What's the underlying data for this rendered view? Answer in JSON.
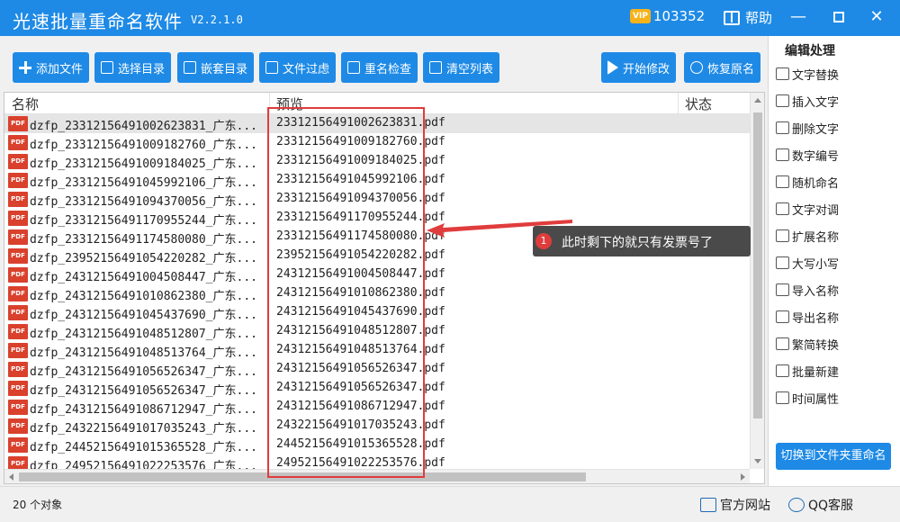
{
  "app": {
    "title": "光速批量重命名软件",
    "version": "V2.2.1.0",
    "vip_label": "VIP",
    "user_id": "103352",
    "help_label": "帮助",
    "window_controls": {
      "minimize": "—",
      "close": "✕"
    }
  },
  "toolbar": {
    "add_files": "添加文件",
    "select_dir": "选择目录",
    "nested_dir": "嵌套目录",
    "file_filter": "文件过虑",
    "rename_check": "重名检查",
    "clear_list": "清空列表",
    "start_modify": "开始修改",
    "restore_names": "恢复原名"
  },
  "list": {
    "headers": {
      "name": "名称",
      "preview": "预览",
      "status": "状态"
    },
    "rows": [
      {
        "name": "dzfp_23312156491002623831_广东...",
        "preview": "23312156491002623831.pdf"
      },
      {
        "name": "dzfp_23312156491009182760_广东...",
        "preview": "23312156491009182760.pdf"
      },
      {
        "name": "dzfp_23312156491009184025_广东...",
        "preview": "23312156491009184025.pdf"
      },
      {
        "name": "dzfp_23312156491045992106_广东...",
        "preview": "23312156491045992106.pdf"
      },
      {
        "name": "dzfp_23312156491094370056_广东...",
        "preview": "23312156491094370056.pdf"
      },
      {
        "name": "dzfp_23312156491170955244_广东...",
        "preview": "23312156491170955244.pdf"
      },
      {
        "name": "dzfp_23312156491174580080_广东...",
        "preview": "23312156491174580080.pdf"
      },
      {
        "name": "dzfp_23952156491054220282_广东...",
        "preview": "23952156491054220282.pdf"
      },
      {
        "name": "dzfp_24312156491004508447_广东...",
        "preview": "24312156491004508447.pdf"
      },
      {
        "name": "dzfp_24312156491010862380_广东...",
        "preview": "24312156491010862380.pdf"
      },
      {
        "name": "dzfp_24312156491045437690_广东...",
        "preview": "24312156491045437690.pdf"
      },
      {
        "name": "dzfp_24312156491048512807_广东...",
        "preview": "24312156491048512807.pdf"
      },
      {
        "name": "dzfp_24312156491048513764_广东...",
        "preview": "24312156491048513764.pdf"
      },
      {
        "name": "dzfp_24312156491056526347_广东...",
        "preview": "24312156491056526347.pdf"
      },
      {
        "name": "dzfp_24312156491056526347_广东...",
        "preview": "24312156491056526347.pdf"
      },
      {
        "name": "dzfp_24312156491086712947_广东...",
        "preview": "24312156491086712947.pdf"
      },
      {
        "name": "dzfp_24322156491017035243_广东...",
        "preview": "24322156491017035243.pdf"
      },
      {
        "name": "dzfp_24452156491015365528_广东...",
        "preview": "24452156491015365528.pdf"
      },
      {
        "name": "dzfp_24952156491022253576_广东...",
        "preview": "24952156491022253576.pdf"
      }
    ],
    "file_icon_label": "PDF"
  },
  "annotation": {
    "number": "1",
    "text": "此时剩下的就只有发票号了"
  },
  "sidepanel": {
    "title": "编辑处理",
    "items": [
      "文字替换",
      "插入文字",
      "删除文字",
      "数字编号",
      "随机命名",
      "文字对调",
      "扩展名称",
      "大写小写",
      "导入名称",
      "导出名称",
      "繁简转换",
      "批量新建",
      "时间属性"
    ],
    "switch_button": "切换到文件夹重命名"
  },
  "statusbar": {
    "object_count": "20 个对象",
    "website": "官方网站",
    "qq_service": "QQ客服"
  },
  "colors": {
    "accent": "#1e8ae6",
    "annotation_red": "#e03c3c",
    "callout_bg": "#4a4a4a",
    "pdf_red": "#d9412d"
  }
}
